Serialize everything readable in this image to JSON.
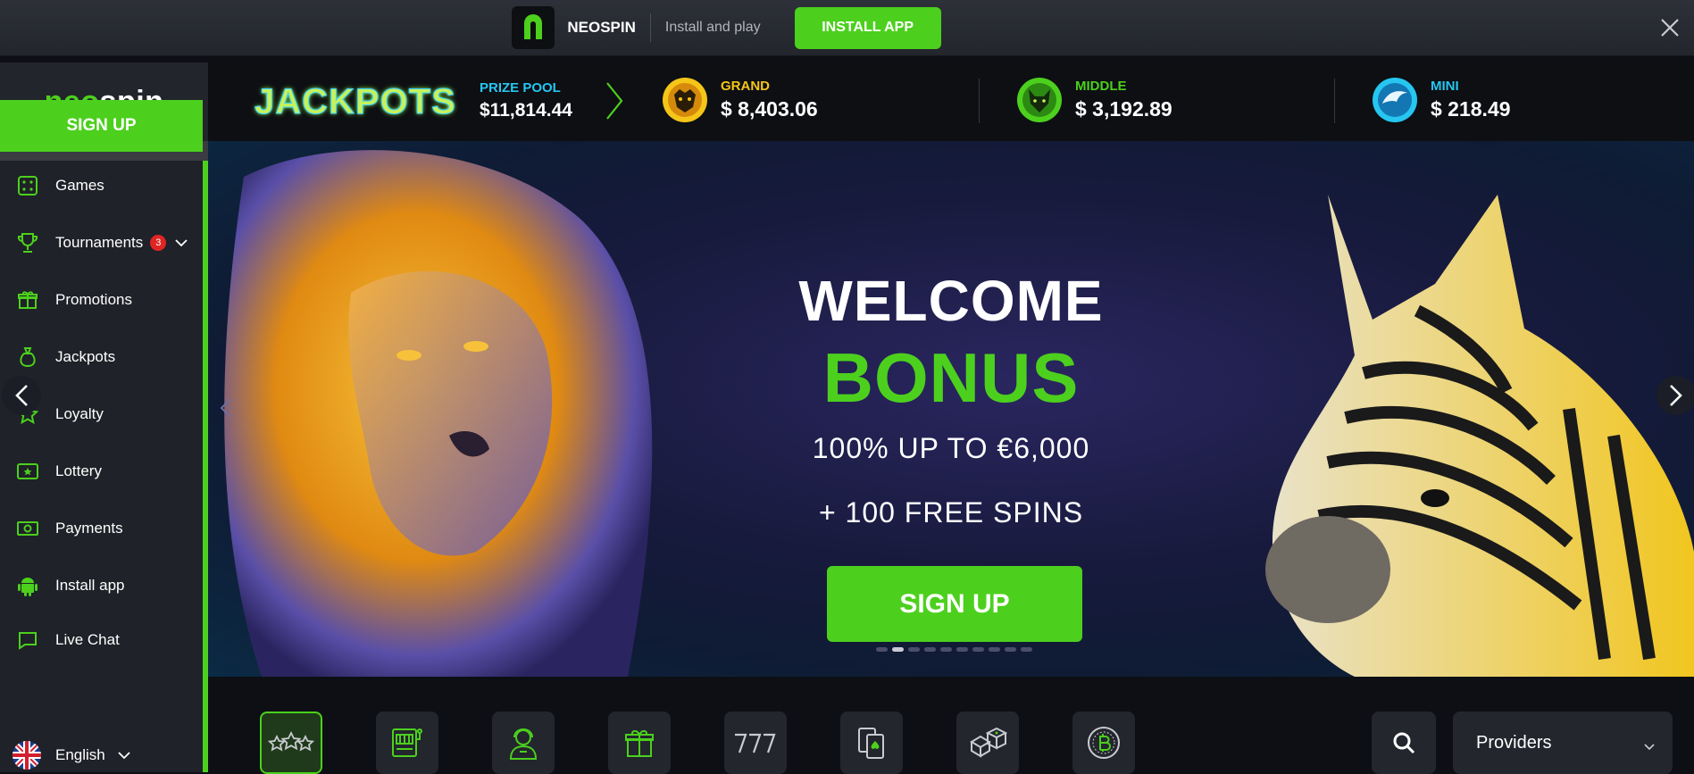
{
  "topbar": {
    "app_name": "NEOSPIN",
    "subtitle": "Install and play",
    "install_label": "INSTALL APP"
  },
  "sidebar": {
    "logo": {
      "part1": "ne",
      "part2": "o",
      "part3": "spin"
    },
    "signup_label": "SIGN UP",
    "items": [
      {
        "label": "Games",
        "icon": "dice-icon"
      },
      {
        "label": "Tournaments",
        "icon": "trophy-icon",
        "badge": "3"
      },
      {
        "label": "Promotions",
        "icon": "gift-icon"
      },
      {
        "label": "Jackpots",
        "icon": "moneybag-icon"
      },
      {
        "label": "Loyalty",
        "icon": "star-icon"
      },
      {
        "label": "Lottery",
        "icon": "ticket-icon"
      },
      {
        "label": "Payments",
        "icon": "banknote-icon"
      },
      {
        "label": "Install app",
        "icon": "android-icon"
      },
      {
        "label": "Live Chat",
        "icon": "chat-icon"
      }
    ],
    "language": "English"
  },
  "jackpots": {
    "title": "JACKPOTS",
    "pool_label": "PRIZE POOL",
    "pool_value": "$11,814.44",
    "items": [
      {
        "label": "GRAND",
        "value": "$ 8,403.06",
        "color": "#f5c518"
      },
      {
        "label": "MIDDLE",
        "value": "$ 3,192.89",
        "color": "#4cd01d"
      },
      {
        "label": "MINI",
        "value": "$ 218.49",
        "color": "#26c6f0"
      }
    ]
  },
  "hero": {
    "line1": "WELCOME",
    "line2": "BONUS",
    "line3": "100% UP TO €6,000",
    "line4": "+ 100 FREE SPINS",
    "cta": "SIGN UP"
  },
  "categories": {
    "providers_label": "Providers"
  },
  "colors": {
    "accent": "#4cd01d",
    "background": "#0d0f14",
    "sidebar": "#1f2228"
  }
}
